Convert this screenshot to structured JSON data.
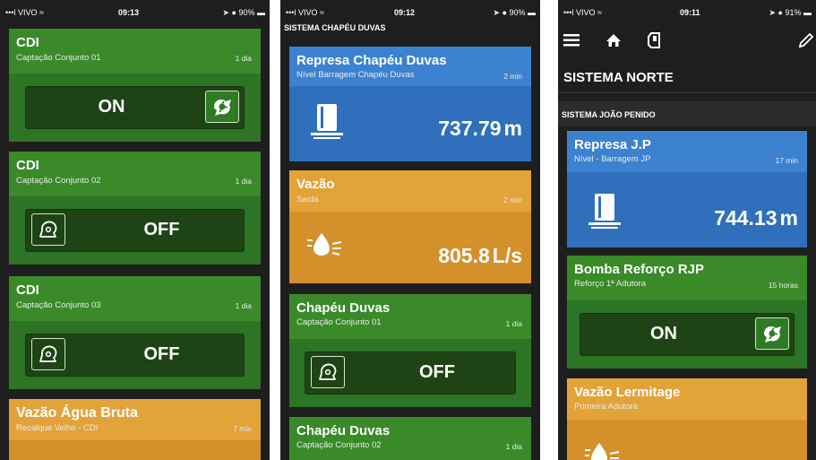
{
  "phone1": {
    "status": {
      "carrier": "•••l VIVO ≈",
      "time": "09:13",
      "battery": "➤ ● 90% ▬"
    },
    "cards": [
      {
        "title": "CDI",
        "subtitle": "Captação Conjunto 01",
        "age": "1 dia",
        "state": "ON"
      },
      {
        "title": "CDI",
        "subtitle": "Captação Conjunto 02",
        "age": "1 dia",
        "state": "OFF"
      },
      {
        "title": "CDI",
        "subtitle": "Captação Conjunto 03",
        "age": "1 dia",
        "state": "OFF"
      },
      {
        "title": "Vazão Água Bruta",
        "subtitle": "Recalque Velho - CDI",
        "age": "7 min"
      }
    ]
  },
  "phone2": {
    "status": {
      "carrier": "•••l VIVO ≈",
      "time": "09:12",
      "battery": "➤ ● 90% ▬"
    },
    "section_header": "SISTEMA CHAPÉU DUVAS",
    "cards": [
      {
        "title": "Represa Chapéu Duvas",
        "subtitle": "Nível Barragem Chapéu Duvas",
        "age": "2 min",
        "value": "737.79",
        "unit": "m"
      },
      {
        "title": "Vazão",
        "subtitle": "Saída",
        "age": "2 min",
        "value": "805.8",
        "unit": "L/s"
      },
      {
        "title": "Chapéu Duvas",
        "subtitle": "Captação Conjunto 01",
        "age": "1 dia",
        "state": "OFF"
      },
      {
        "title": "Chapéu Duvas",
        "subtitle": "Captação Conjunto 02",
        "age": "1 dia"
      }
    ]
  },
  "phone3": {
    "status": {
      "carrier": "•••l VIVO ≈",
      "time": "09:11",
      "battery": "➤ ● 91% ▬"
    },
    "page_title": "SISTEMA NORTE",
    "section_header": "SISTEMA JOÃO PENIDO",
    "cards": [
      {
        "title": "Represa J.P",
        "subtitle": "Nível - Barragem JP",
        "age": "17 min",
        "value": "744.13",
        "unit": "m"
      },
      {
        "title": "Bomba Reforço RJP",
        "subtitle": "Reforço 1ª Adutora",
        "age": "15 horas",
        "state": "ON"
      },
      {
        "title": "Vazão Lermitage",
        "subtitle": "Primeira Adutora"
      }
    ]
  },
  "colors": {
    "green": "#3a8a2a",
    "orange": "#e2a339",
    "blue": "#3c82d1",
    "dark": "#1e1e1e"
  },
  "icons": [
    "menu-icon",
    "home-icon",
    "device-icon",
    "edit-icon",
    "pump-icon",
    "tank-icon",
    "water-drop-icon"
  ]
}
